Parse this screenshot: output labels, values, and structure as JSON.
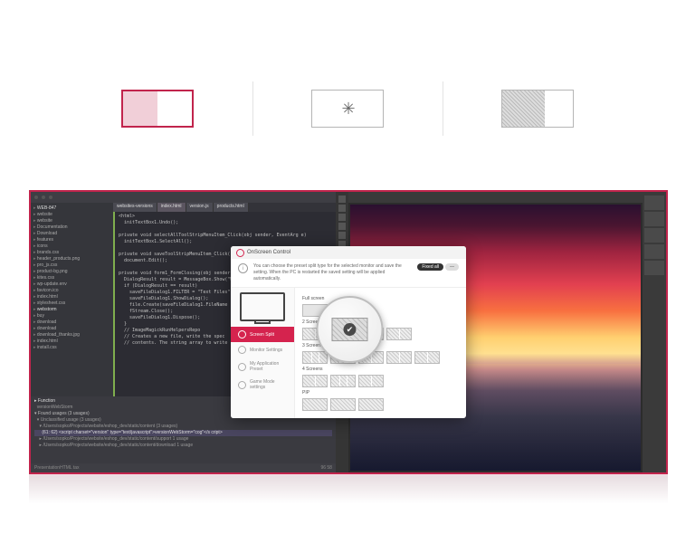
{
  "tabs": {
    "split_label": "split",
    "loading_label": "loading",
    "placeholder_label": "placeholder"
  },
  "accent_color": "#c1244c",
  "ide": {
    "tabs": [
      "websites-versions",
      "index.html",
      "version.js",
      "products.html"
    ],
    "active_tab": "index.html",
    "tree_root": "WEB-847",
    "tree": [
      "website",
      "website",
      "Documentation",
      "Download",
      "features",
      "icons",
      "brands.css",
      "header_products.png",
      "pro_js.css",
      "product-bg.png",
      "kites.css",
      "wp-update.env",
      "favicon.ico",
      "index.html",
      "stylesheet.css",
      "webstorm",
      "buy",
      "download",
      "download",
      "download_thanks.jpg",
      "index.html",
      "install.css"
    ],
    "code": "<html>\n  initTextBox1.Undo();\n\nprivate void selectAllToolStripMenuItem_Click(obj sender, EventArg e)\n  initTextBox1.SelectAll();\n\nprivate void saveToolStripMenuItem_Click()\n  document.Edit();\n\nprivate void form1_FormClosing(obj sender,\n  DialogResult result = MessageBox.Show(\"Want\n  if (DialogResult == result)\n    saveFileDialog1.FILTER = \"Text Files\";\n    saveFileDialog1.ShowDialog();\n    file.Create(saveFileDialog1.FileName\n    fStream.Close();\n    saveFileDialog1.Dispose();\n  }\n  // ImageMagickRunHelpersRepo\n  // Creates a new file, write the spec\n  // contents. The string array to write",
    "footer": {
      "section": "Function",
      "found": "Found usages (3 usages)",
      "items": [
        "versionWebStorm",
        "Unclassified usage (3 usages)",
        "/Users/sopko/Projects/website/eshop_dev/static/content (3 usages)",
        "(61: 62) <script charset=\"version\" type=\"text/javascript\">versionWebStorm=\"cog\"</s cript>",
        "/Users/sopko/Projects/website/eshop_dev/static/content/support 1 usage",
        "/Users/sopko/Projects/website/eshop_dev/static/content/download 1 usage"
      ]
    },
    "status_left": "PresentationHTML tax",
    "status_right": "96 58"
  },
  "osc": {
    "title": "OnScreen Control",
    "info": "You can choose the preset split type for the selected monitor and save the setting. When the PC is restarted the saved setting will be applied automatically.",
    "toggle_on": "Fixed all",
    "toggle_off": "—",
    "side": {
      "active": "Screen Split",
      "items": [
        "Monitor Settings",
        "My Application Preset",
        "Game Mode settings"
      ]
    },
    "sections": [
      "Full screen",
      "2 Screens",
      "3 Screens",
      "4 Screens",
      "PIP"
    ]
  },
  "photoshop": {
    "app": "image-editor"
  }
}
